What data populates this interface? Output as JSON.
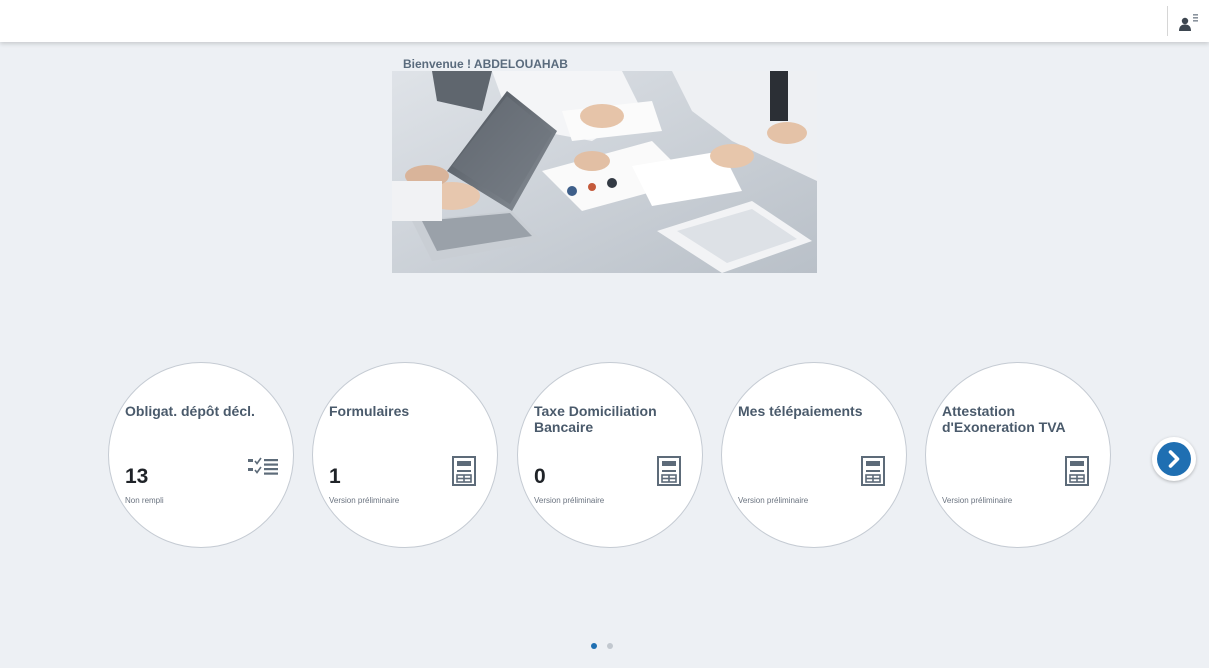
{
  "header": {
    "user_icon": "user-menu-icon"
  },
  "welcome": {
    "text": "Bienvenue ! ABDELOUAHAB"
  },
  "hero": {
    "image": "business-meeting-laptops-photo"
  },
  "tiles": [
    {
      "title": "Obligat. dépôt décl.",
      "count": "13",
      "subtitle": "Non rempli",
      "icon": "checklist-icon"
    },
    {
      "title": "Formulaires",
      "count": "1",
      "subtitle": "Version préliminaire",
      "icon": "form-icon"
    },
    {
      "title": "Taxe Domiciliation Bancaire",
      "count": "0",
      "subtitle": "Version préliminaire",
      "icon": "form-icon"
    },
    {
      "title": "Mes télépaiements",
      "count": "",
      "subtitle": "Version préliminaire",
      "icon": "form-icon"
    },
    {
      "title": "Attestation d'Exoneration TVA",
      "count": "",
      "subtitle": "Version préliminaire",
      "icon": "form-icon"
    }
  ],
  "carousel": {
    "next_icon": "chevron-right-icon",
    "pages": 2,
    "active_page": 1
  },
  "colors": {
    "background": "#edf0f4",
    "accent": "#1f6fb2",
    "tile_title": "#4a5a6b",
    "active_dot": "#1f6fb2",
    "inactive_dot": "#c2c8cf"
  }
}
